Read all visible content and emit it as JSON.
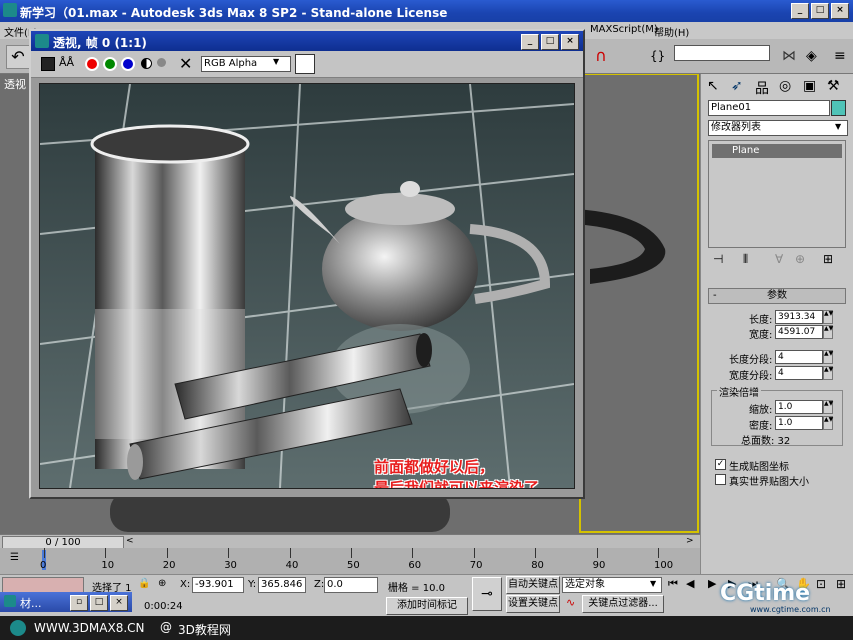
{
  "app": {
    "title": "新学习（01.max - Autodesk 3ds Max 8 SP2  - Stand-alone License",
    "menu": [
      "文件(F)",
      "MAXScript(M)",
      "帮助(H)"
    ],
    "min": "_",
    "max": "□",
    "close": "×"
  },
  "viewport": {
    "label": "透视"
  },
  "render_window": {
    "title": "透视, 帧 0 (1:1)",
    "channel": "RGB Alpha",
    "min": "_",
    "max": "□",
    "close": "×",
    "caption_line1": "前面都做好以后，",
    "caption_line2": "最后我们就可以来渲染了……"
  },
  "command_panel": {
    "object_name": "Plane01",
    "modifier_list": "修改器列表",
    "stack_item": "Plane",
    "rollout_title": "参数",
    "length_label": "长度:",
    "length_value": "3913.34",
    "width_label": "宽度:",
    "width_value": "4591.07",
    "length_segs_label": "长度分段:",
    "length_segs_value": "4",
    "width_segs_label": "宽度分段:",
    "width_segs_value": "4",
    "render_mult_label": "渲染倍增",
    "scale_label": "缩放:",
    "scale_value": "1.0",
    "density_label": "密度:",
    "density_value": "1.0",
    "total_faces": "总面数: 32",
    "gen_map_coords": "生成贴图坐标",
    "real_world_map": "真实世界贴图大小"
  },
  "timeline": {
    "frame_display": "0 / 100",
    "ticks": [
      "0",
      "10",
      "20",
      "30",
      "40",
      "50",
      "60",
      "70",
      "80",
      "90",
      "100"
    ]
  },
  "status": {
    "selected": "选择了 1",
    "x_label": "X:",
    "x_value": "-93.901",
    "y_label": "Y:",
    "y_value": "365.846",
    "z_label": "Z:",
    "z_value": "0.0",
    "grid": "栅格 = 10.0",
    "auto_key": "自动关键点",
    "set_key": "设置关键点",
    "selected_objects": "选定对象",
    "key_filters": "关键点过滤器...",
    "time": "0:00:24",
    "add_time_tag": "添加时间标记",
    "min_window": "材..."
  },
  "taskbar": {
    "site1": "WWW.3DMAX8.CN",
    "site2": "3D教程网"
  },
  "watermark": {
    "brand": "CGtime",
    "url": "www.cgtime.com.cn"
  }
}
